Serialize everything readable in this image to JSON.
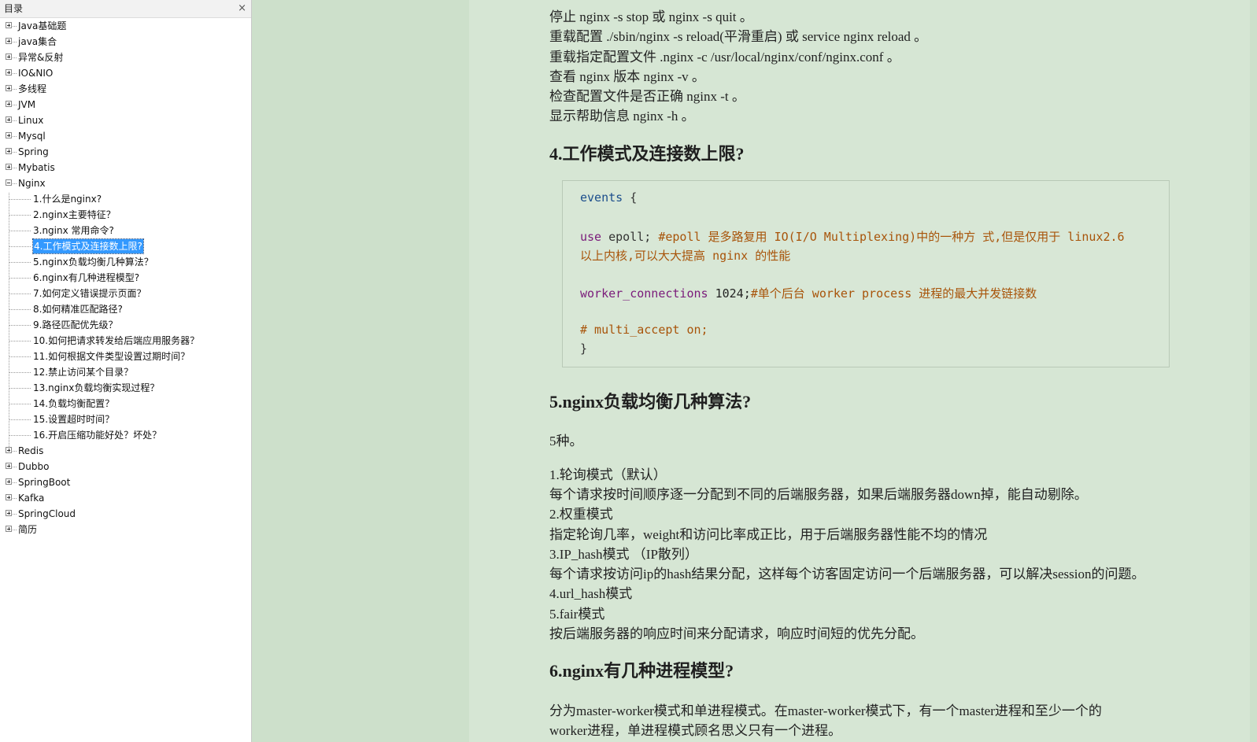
{
  "toc": {
    "title": "目录",
    "close_label": "×",
    "top_items": [
      {
        "label": "Java基础题",
        "expanded": false
      },
      {
        "label": "java集合",
        "expanded": false
      },
      {
        "label": "异常&反射",
        "expanded": false
      },
      {
        "label": "IO&NIO",
        "expanded": false
      },
      {
        "label": "多线程",
        "expanded": false
      },
      {
        "label": "JVM",
        "expanded": false
      },
      {
        "label": "Linux",
        "expanded": false
      },
      {
        "label": "Mysql",
        "expanded": false
      },
      {
        "label": "Spring",
        "expanded": false
      },
      {
        "label": "Mybatis",
        "expanded": false
      },
      {
        "label": "Nginx",
        "expanded": true
      }
    ],
    "nginx_children": [
      "1.什么是nginx?",
      "2.nginx主要特征？",
      "3.nginx 常用命令?",
      "4.工作模式及连接数上限?",
      "5.nginx负载均衡几种算法？",
      "6.nginx有几种进程模型?",
      "7.如何定义错误提示页面？",
      "8.如何精准匹配路径?",
      "9.路径匹配优先级？",
      "10.如何把请求转发给后端应用服务器？",
      "11.如何根据文件类型设置过期时间？",
      "12.禁止访问某个目录？",
      "13.nginx负载均衡实现过程？",
      "14.负载均衡配置？",
      "15.设置超时时间？",
      "16.开启压缩功能好处？坏处？"
    ],
    "selected_child": "4.工作模式及连接数上限?",
    "bottom_items": [
      {
        "label": "Redis",
        "expanded": false
      },
      {
        "label": "Dubbo",
        "expanded": false
      },
      {
        "label": "SpringBoot",
        "expanded": false
      },
      {
        "label": "Kafka",
        "expanded": false
      },
      {
        "label": "SpringCloud",
        "expanded": false
      },
      {
        "label": "简历",
        "expanded": false
      }
    ]
  },
  "document": {
    "commands": [
      "停止 nginx -s stop 或 nginx -s quit 。",
      "重载配置 ./sbin/nginx -s reload(平滑重启) 或 service nginx reload 。",
      "重载指定配置文件 .nginx -c /usr/local/nginx/conf/nginx.conf 。",
      "查看 nginx 版本 nginx -v 。",
      "检查配置文件是否正确 nginx -t 。",
      "显示帮助信息 nginx -h 。"
    ],
    "heading4": "4.工作模式及连接数上限?",
    "code": {
      "events_kw": "events",
      "events_brace": " {",
      "use_kw": "use",
      "use_val": " epoll; ",
      "use_comment_1": "#epoll 是多路复用 IO(I/O Multiplexing)中的一种方 式,但是仅用于 linux2.6",
      "use_comment_2": "以上内核,可以大大提高 nginx 的性能",
      "wc_kw": "worker_connections",
      "wc_val": " 1024;",
      "wc_comment": "#单个后台 worker process 进程的最大并发链接数",
      "multi_comment": "# multi_accept on;",
      "close_brace": "}"
    },
    "heading5": "5.nginx负载均衡几种算法?",
    "count_text": "5种。",
    "algorithms": [
      "1.轮询模式（默认）",
      "每个请求按时间顺序逐一分配到不同的后端服务器，如果后端服务器down掉，能自动剔除。",
      "2.权重模式",
      "指定轮询几率，weight和访问比率成正比，用于后端服务器性能不均的情况",
      "3.IP_hash模式 （IP散列）",
      "每个请求按访问ip的hash结果分配，这样每个访客固定访问一个后端服务器，可以解决session的问题。",
      "4.url_hash模式",
      "5.fair模式",
      "按后端服务器的响应时间来分配请求，响应时间短的优先分配。"
    ],
    "heading6": "6.nginx有几种进程模型?",
    "process_text_1": "分为master-worker模式和单进程模式。在master-worker模式下，有一个master进程和至少一个的",
    "process_text_2": "worker进程，单进程模式顾名思义只有一个进程。"
  }
}
